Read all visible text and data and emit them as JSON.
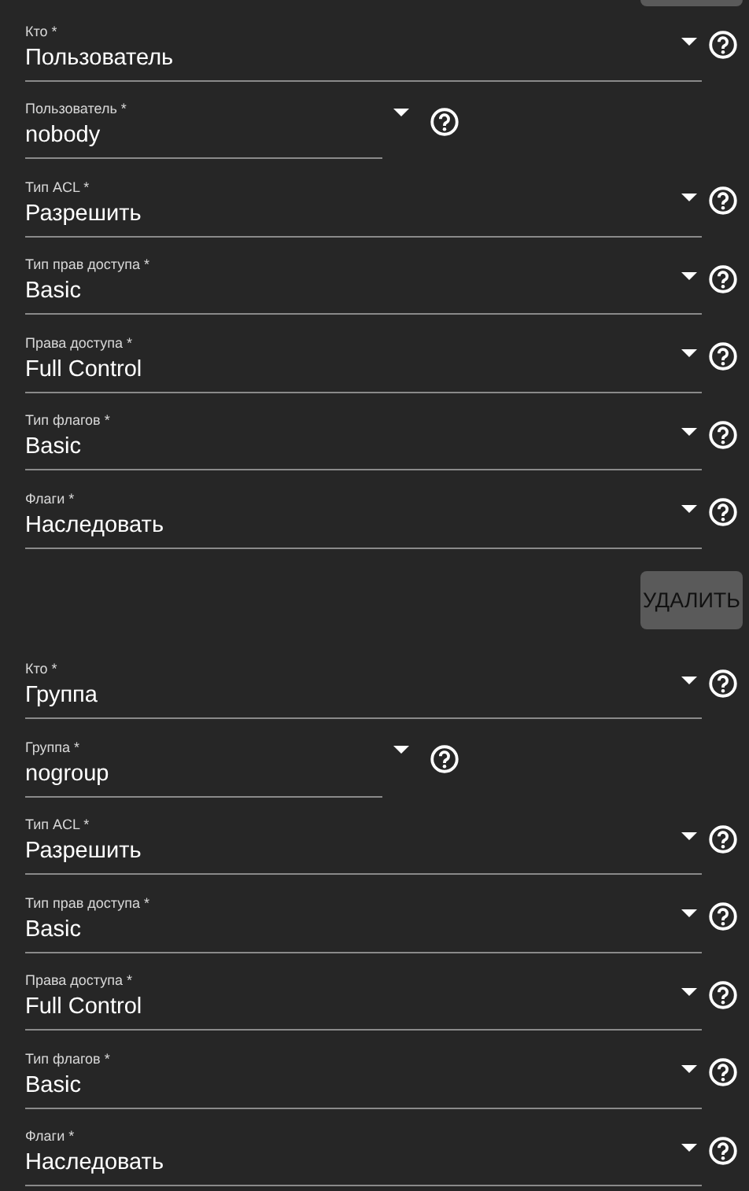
{
  "entries": [
    {
      "fields": [
        {
          "kind": "select",
          "label": "Кто *",
          "value": "Пользователь"
        },
        {
          "kind": "combobox",
          "label": "Пользователь *",
          "value": "nobody"
        },
        {
          "kind": "select",
          "label": "Тип ACL *",
          "value": "Разрешить"
        },
        {
          "kind": "select",
          "label": "Тип прав доступа *",
          "value": "Basic"
        },
        {
          "kind": "select",
          "label": "Права доступа *",
          "value": "Full Control"
        },
        {
          "kind": "select",
          "label": "Тип флагов *",
          "value": "Basic"
        },
        {
          "kind": "select",
          "label": "Флаги *",
          "value": "Наследовать"
        }
      ],
      "delete_button": "УДАЛИТЬ"
    },
    {
      "fields": [
        {
          "kind": "select",
          "label": "Кто *",
          "value": "Группа"
        },
        {
          "kind": "combobox",
          "label": "Группа *",
          "value": "nogroup"
        },
        {
          "kind": "select",
          "label": "Тип ACL *",
          "value": "Разрешить"
        },
        {
          "kind": "select",
          "label": "Тип прав доступа *",
          "value": "Basic"
        },
        {
          "kind": "select",
          "label": "Права доступа *",
          "value": "Full Control"
        },
        {
          "kind": "select",
          "label": "Тип флагов *",
          "value": "Basic"
        },
        {
          "kind": "select",
          "label": "Флаги *",
          "value": "Наследовать"
        }
      ]
    }
  ]
}
